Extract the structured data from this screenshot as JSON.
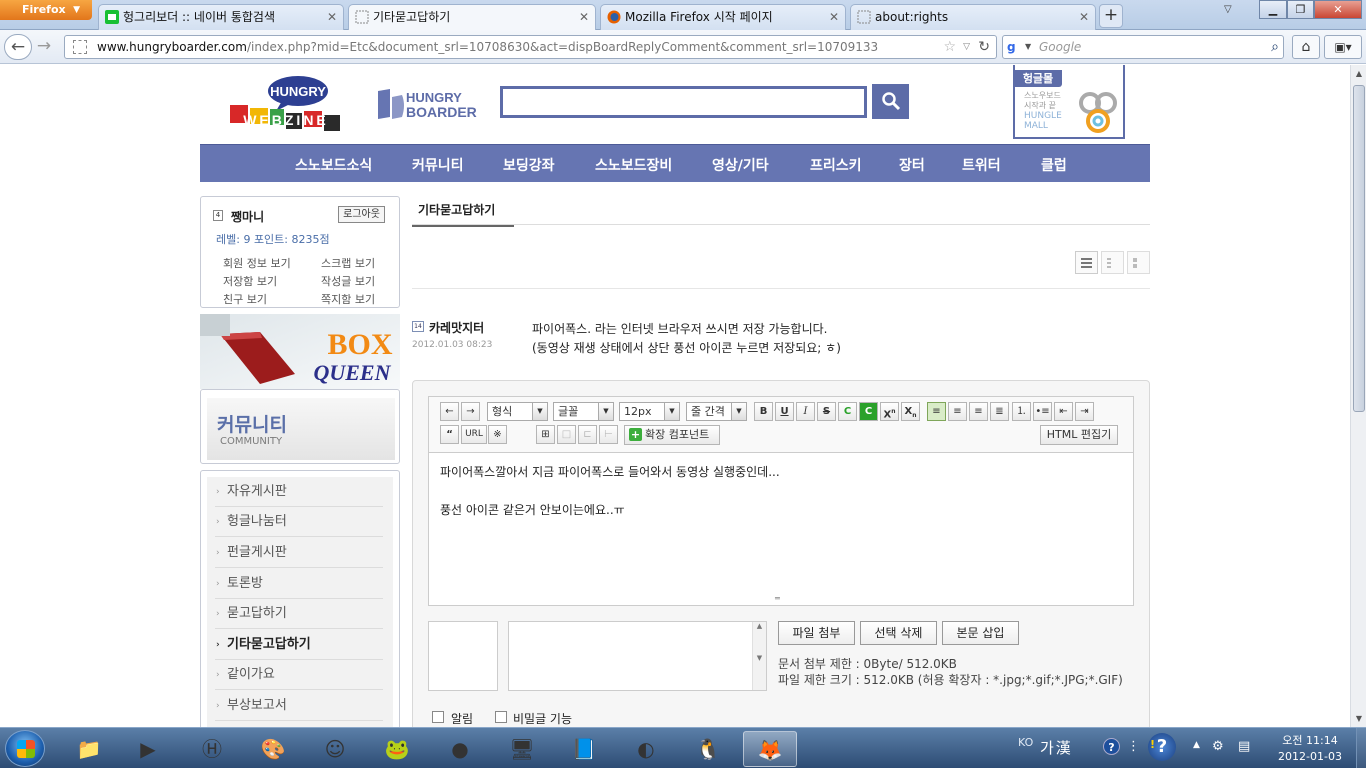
{
  "browser": {
    "menu_button": "Firefox",
    "tabs": [
      {
        "label": "헝그리보더 :: 네이버 통합검색",
        "active": false
      },
      {
        "label": "기타묻고답하기",
        "active": true
      },
      {
        "label": "Mozilla Firefox 시작 페이지",
        "active": false
      },
      {
        "label": "about:rights",
        "active": false
      }
    ],
    "url_host": "www.hungryboarder.com",
    "url_path": "/index.php?mid=Etc&document_srl=10708630&act=dispBoardReplyComment&comment_srl=10709133",
    "search_placeholder": "Google"
  },
  "site": {
    "logo_webzine": {
      "top": "HUNGRY",
      "bottom": "WEBZINE"
    },
    "logo_brand": {
      "line1": "HUNGRY",
      "line2": "BOARDER"
    },
    "mall": {
      "tag": "헝글몰",
      "lines": [
        "스노우보드",
        "시작과 끝",
        "HUNGLE",
        "MALL"
      ]
    },
    "nav": [
      "스노보드소식",
      "커뮤니티",
      "보딩강좌",
      "스노보드장비",
      "영상/기타",
      "프리스키",
      "장터",
      "트위터",
      "클럽"
    ]
  },
  "sidebar": {
    "user_name": "쨍마니",
    "logout_label": "로그아웃",
    "level_text": "레벨: 9  포인트: 8235점",
    "links": [
      "회원 정보 보기",
      "스크랩 보기",
      "저장함 보기",
      "작성글 보기",
      "친구 보기",
      "쪽지함 보기"
    ],
    "banner": {
      "line1": "BOX",
      "line2": "QUEEN"
    },
    "community_title": "커뮤니티",
    "community_sub": "COMMUNITY",
    "boards": [
      {
        "label": "자유게시판",
        "active": false
      },
      {
        "label": "헝글나눔터",
        "active": false
      },
      {
        "label": "펀글게시판",
        "active": false
      },
      {
        "label": "토론방",
        "active": false
      },
      {
        "label": "묻고답하기",
        "active": false
      },
      {
        "label": "기타묻고답하기",
        "active": true
      },
      {
        "label": "같이가요",
        "active": false
      },
      {
        "label": "부상보고서",
        "active": false
      }
    ]
  },
  "main": {
    "tab_label": "기타묻고답하기",
    "comment": {
      "author": "카레맛지터",
      "date": "2012.01.03 08:23",
      "lines": [
        "파이어폭스. 라는 인터넷 브라우저 쓰시면 저장 가능합니다.",
        "(동영상 재생 상태에서 상단 풍선 아이콘 누르면 저장되요; ㅎ)"
      ]
    },
    "editor": {
      "format_select": "형식",
      "font_select": "글꼴",
      "size_select": "12px",
      "line_height_select": "줄 간격",
      "quote_label": "“",
      "url_label": "URL",
      "special_label": "※",
      "ext_component_label": "확장 컴포넌트",
      "html_edit_label": "HTML 편집기",
      "body_lines": [
        "파이어폭스깔아서 지금 파이어폭스로 들어와서 동영상 실행중인데...",
        "",
        "풍선 아이콘 같은거 안보이는에요..ㅠ"
      ]
    },
    "upload": {
      "attach_label": "파일 첨부",
      "delete_label": "선택 삭제",
      "insert_label": "본문 삽입",
      "limit_text": "문서 첨부 제한 : 0Byte/ 512.0KB",
      "size_text": "파일 제한 크기 : 512.0KB (허용 확장자 : *.jpg;*.gif;*.JPG;*.GIF)"
    },
    "options": {
      "notify_label": "알림",
      "secret_label": "비밀글 기능"
    }
  },
  "taskbar": {
    "tray_lang": "KO",
    "tray_ime": "가漢",
    "clock_time": "오전 11:14",
    "clock_date": "2012-01-03"
  },
  "colors": {
    "accent": "#6675b2",
    "accent_dark": "#5d6ca8"
  }
}
